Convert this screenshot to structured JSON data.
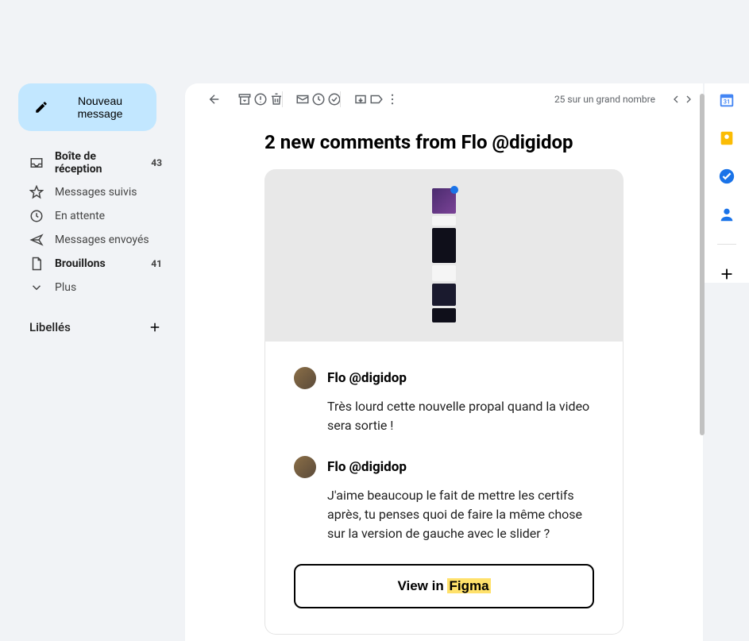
{
  "compose": {
    "label": "Nouveau message"
  },
  "nav": [
    {
      "icon": "inbox",
      "label": "Boîte de réception",
      "count": "43",
      "bold": true
    },
    {
      "icon": "star",
      "label": "Messages suivis",
      "count": "",
      "bold": false
    },
    {
      "icon": "clock",
      "label": "En attente",
      "count": "",
      "bold": false
    },
    {
      "icon": "send",
      "label": "Messages envoyés",
      "count": "",
      "bold": false
    },
    {
      "icon": "file",
      "label": "Brouillons",
      "count": "41",
      "bold": true
    },
    {
      "icon": "chevron-down",
      "label": "Plus",
      "count": "",
      "bold": false
    }
  ],
  "labels": {
    "title": "Libellés"
  },
  "toolbar": {
    "pagination": "25 sur un grand nombre"
  },
  "email": {
    "subject": "2 new comments from Flo @digidop",
    "comments": [
      {
        "author": "Flo @digidop",
        "text": "Très lourd cette nouvelle propal quand la video sera sortie !"
      },
      {
        "author": "Flo @digidop",
        "text": "J'aime beaucoup le fait de mettre les certifs après, tu penses quoi de faire la même chose sur la version de gauche avec le slider ?"
      }
    ],
    "cta_prefix": "View in ",
    "cta_highlight": "Figma"
  }
}
